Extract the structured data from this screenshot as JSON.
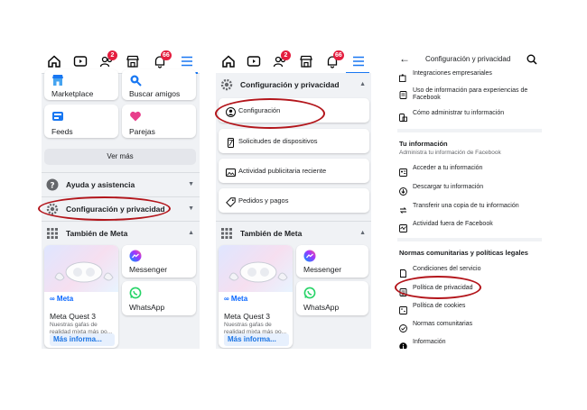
{
  "panel1": {
    "badges": {
      "friends": "2",
      "notifications": "66"
    },
    "cards": [
      {
        "label": "Marketplace",
        "icon": "marketplace-icon"
      },
      {
        "label": "Buscar amigos",
        "icon": "find-friends-icon"
      },
      {
        "label": "Feeds",
        "icon": "feeds-icon"
      },
      {
        "label": "Parejas",
        "icon": "dating-icon"
      }
    ],
    "see_more": "Ver más",
    "help": "Ayuda y asistencia",
    "settings": "Configuración y privacidad",
    "also_meta": "También de Meta",
    "quest": {
      "brand": "∞ Meta",
      "title": "Meta Quest 3",
      "desc": "Nuestras gafas de realidad mixta más po...",
      "more": "Más informa..."
    },
    "apps": [
      {
        "label": "Messenger"
      },
      {
        "label": "WhatsApp"
      }
    ]
  },
  "panel2": {
    "badges": {
      "friends": "2",
      "notifications": "66"
    },
    "section": "Configuración y privacidad",
    "items": [
      {
        "label": "Configuración"
      },
      {
        "label": "Solicitudes de dispositivos"
      },
      {
        "label": "Actividad publicitaria reciente"
      },
      {
        "label": "Pedidos y pagos"
      }
    ],
    "also_meta": "También de Meta",
    "quest": {
      "brand": "∞ Meta",
      "title": "Meta Quest 3",
      "desc": "Nuestras gafas de realidad mixta más po...",
      "more": "Más informa..."
    },
    "apps": [
      {
        "label": "Messenger"
      },
      {
        "label": "WhatsApp"
      }
    ]
  },
  "panel3": {
    "title": "Configuración y privacidad",
    "top_items": [
      {
        "label": "Integraciones empresariales"
      },
      {
        "label": "Uso de información para experiencias de",
        "label2": "Facebook"
      },
      {
        "label": "Cómo administrar tu información"
      }
    ],
    "info_section": {
      "title": "Tu información",
      "subtitle": "Administra tu información de Facebook"
    },
    "info_items": [
      {
        "label": "Acceder a tu información"
      },
      {
        "label": "Descargar tu información"
      },
      {
        "label": "Transferir una copia de tu información"
      },
      {
        "label": "Actividad fuera de Facebook"
      }
    ],
    "norms_section": {
      "title": "Normas comunitarias y políticas legales"
    },
    "norms_items": [
      {
        "label": "Condiciones del servicio"
      },
      {
        "label": "Política de privacidad"
      },
      {
        "label": "Política de cookies"
      },
      {
        "label": "Normas comunitarias"
      },
      {
        "label": "Información"
      }
    ]
  },
  "colors": {
    "accent": "#1877f2",
    "badge": "#e41e3f",
    "highlight_ring": "#b3151b"
  }
}
